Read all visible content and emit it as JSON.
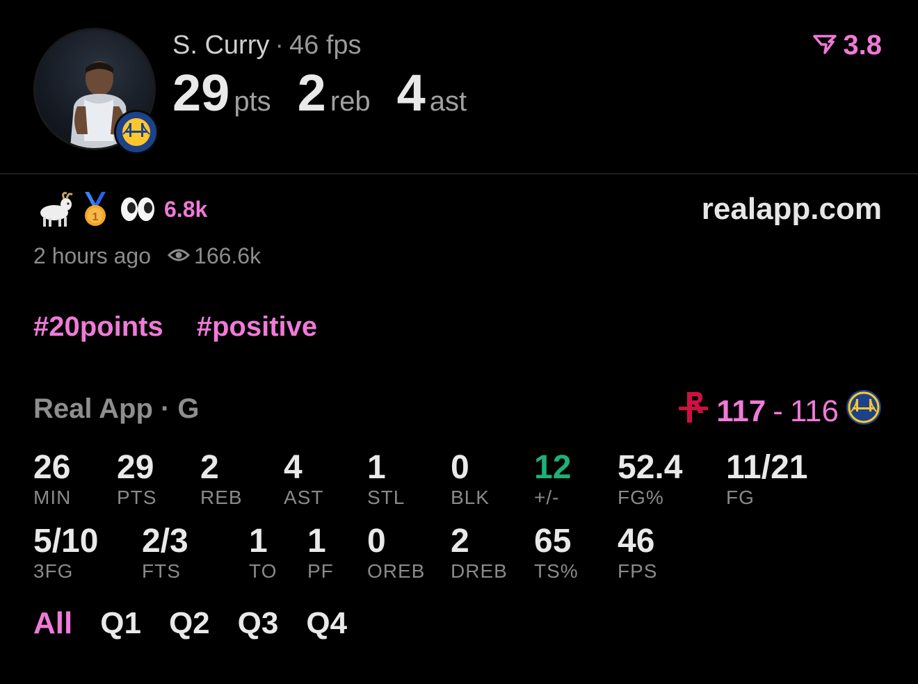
{
  "header": {
    "player_name": "S. Curry",
    "separator": "·",
    "fps_label": "46 fps",
    "rating": "3.8",
    "stats": [
      {
        "value": "29",
        "unit": "pts"
      },
      {
        "value": "2",
        "unit": "reb"
      },
      {
        "value": "4",
        "unit": "ast"
      }
    ]
  },
  "reactions": {
    "icons": [
      "goat-emoji",
      "medal-emoji",
      "eyes-emoji"
    ],
    "count": "6.8k",
    "site": "realapp.com"
  },
  "meta": {
    "time": "2 hours ago",
    "views": "166.6k"
  },
  "tags": [
    "#20points",
    "#positive"
  ],
  "game": {
    "league": "Real App · G",
    "home_score": "117",
    "dash": "-",
    "away_score": "116"
  },
  "stats_row1": [
    {
      "value": "26",
      "label": "MIN"
    },
    {
      "value": "29",
      "label": "PTS"
    },
    {
      "value": "2",
      "label": "REB"
    },
    {
      "value": "4",
      "label": "AST"
    },
    {
      "value": "1",
      "label": "STL"
    },
    {
      "value": "0",
      "label": "BLK"
    },
    {
      "value": "12",
      "label": "+/-"
    },
    {
      "value": "52.4",
      "label": "FG%"
    },
    {
      "value": "11/21",
      "label": "FG"
    }
  ],
  "stats_row2": [
    {
      "value": "5/10",
      "label": "3FG"
    },
    {
      "value": "2/3",
      "label": "FTS"
    },
    {
      "value": "1",
      "label": "TO"
    },
    {
      "value": "1",
      "label": "PF"
    },
    {
      "value": "0",
      "label": "OREB"
    },
    {
      "value": "2",
      "label": "DREB"
    },
    {
      "value": "65",
      "label": "TS%"
    },
    {
      "value": "46",
      "label": "FPS"
    }
  ],
  "tabs": [
    "All",
    "Q1",
    "Q2",
    "Q3",
    "Q4"
  ],
  "colors": {
    "accent": "#f07ad8",
    "positive": "#1db07a",
    "background": "#000000"
  }
}
